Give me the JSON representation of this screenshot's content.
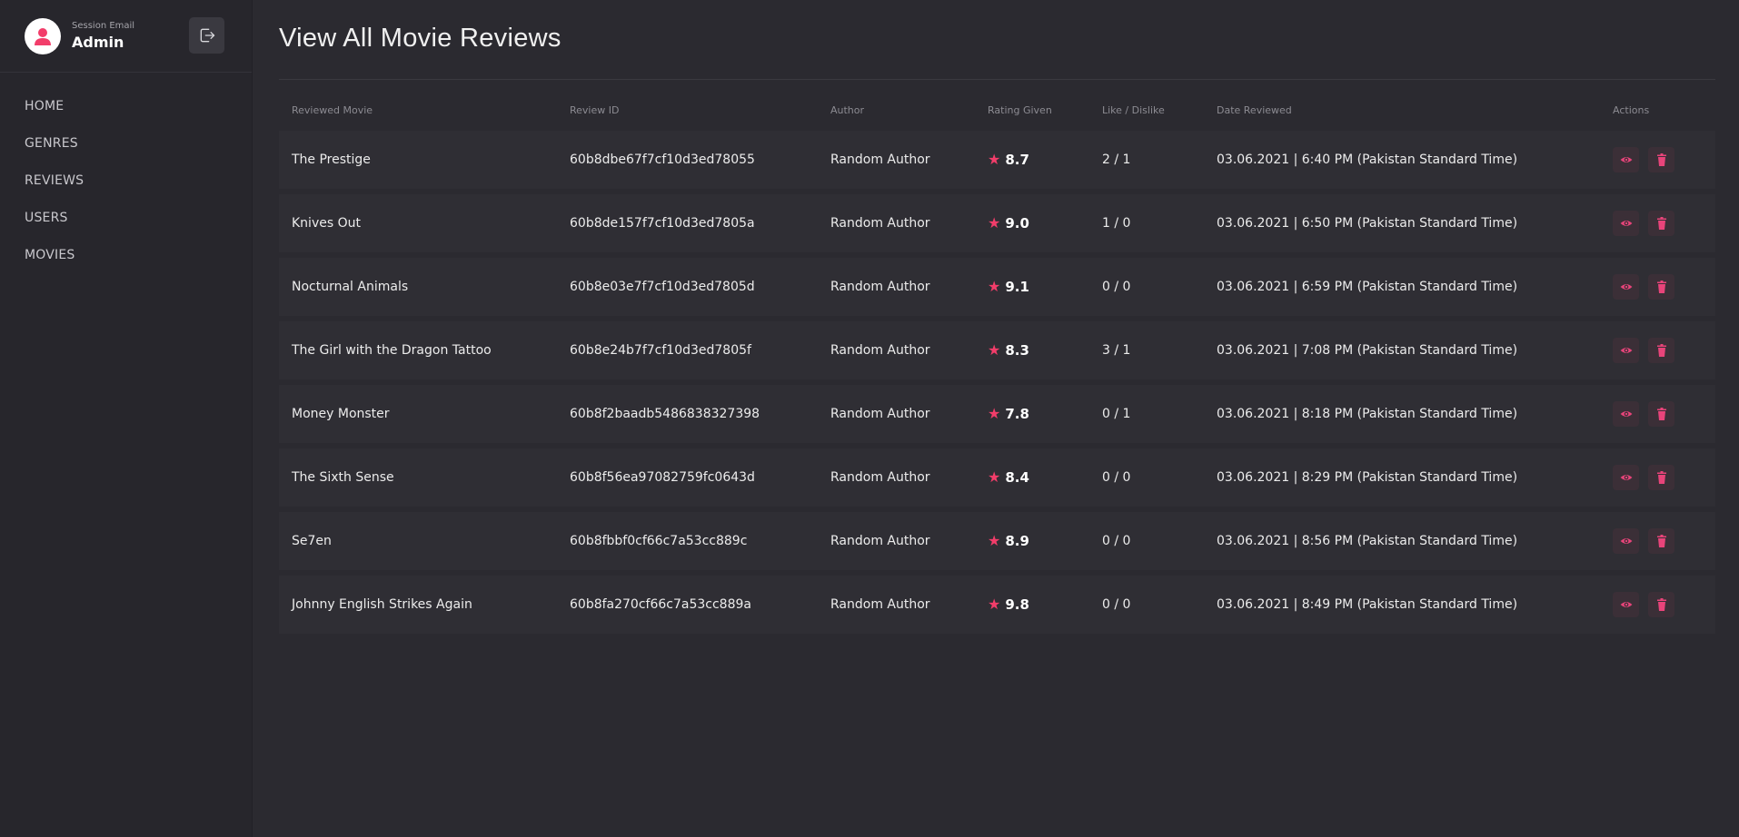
{
  "session": {
    "caption": "Session Email",
    "name": "Admin"
  },
  "nav": [
    "HOME",
    "GENRES",
    "REVIEWS",
    "USERS",
    "MOVIES"
  ],
  "page": {
    "title": "View All Movie Reviews"
  },
  "colors": {
    "accent": "#f23d6a",
    "background": "#2b2a30",
    "sidebar": "#27262c",
    "row": "#2f2e34"
  },
  "icons": {
    "logout": "logout-icon",
    "view": "eye-icon",
    "delete": "trash-icon",
    "rating": "star-icon",
    "avatar": "user-icon"
  },
  "table": {
    "headers": [
      "Reviewed Movie",
      "Review ID",
      "Author",
      "Rating Given",
      "Like / Dislike",
      "Date Reviewed",
      "Actions"
    ],
    "rows": [
      {
        "movie": "The Prestige",
        "id": "60b8dbe67f7cf10d3ed78055",
        "author": "Random Author",
        "rating": "8.7",
        "likes": "2 / 1",
        "date": "03.06.2021 | 6:40 PM (Pakistan Standard Time)"
      },
      {
        "movie": "Knives Out",
        "id": "60b8de157f7cf10d3ed7805a",
        "author": "Random Author",
        "rating": "9.0",
        "likes": "1 / 0",
        "date": "03.06.2021 | 6:50 PM (Pakistan Standard Time)"
      },
      {
        "movie": "Nocturnal Animals",
        "id": "60b8e03e7f7cf10d3ed7805d",
        "author": "Random Author",
        "rating": "9.1",
        "likes": "0 / 0",
        "date": "03.06.2021 | 6:59 PM (Pakistan Standard Time)"
      },
      {
        "movie": "The Girl with the Dragon Tattoo",
        "id": "60b8e24b7f7cf10d3ed7805f",
        "author": "Random Author",
        "rating": "8.3",
        "likes": "3 / 1",
        "date": "03.06.2021 | 7:08 PM (Pakistan Standard Time)"
      },
      {
        "movie": "Money Monster",
        "id": "60b8f2baadb5486838327398",
        "author": "Random Author",
        "rating": "7.8",
        "likes": "0 / 1",
        "date": "03.06.2021 | 8:18 PM (Pakistan Standard Time)"
      },
      {
        "movie": "The Sixth Sense",
        "id": "60b8f56ea97082759fc0643d",
        "author": "Random Author",
        "rating": "8.4",
        "likes": "0 / 0",
        "date": "03.06.2021 | 8:29 PM (Pakistan Standard Time)"
      },
      {
        "movie": "Se7en",
        "id": "60b8fbbf0cf66c7a53cc889c",
        "author": "Random Author",
        "rating": "8.9",
        "likes": "0 / 0",
        "date": "03.06.2021 | 8:56 PM (Pakistan Standard Time)"
      },
      {
        "movie": "Johnny English Strikes Again",
        "id": "60b8fa270cf66c7a53cc889a",
        "author": "Random Author",
        "rating": "9.8",
        "likes": "0 / 0",
        "date": "03.06.2021 | 8:49 PM (Pakistan Standard Time)"
      }
    ]
  }
}
